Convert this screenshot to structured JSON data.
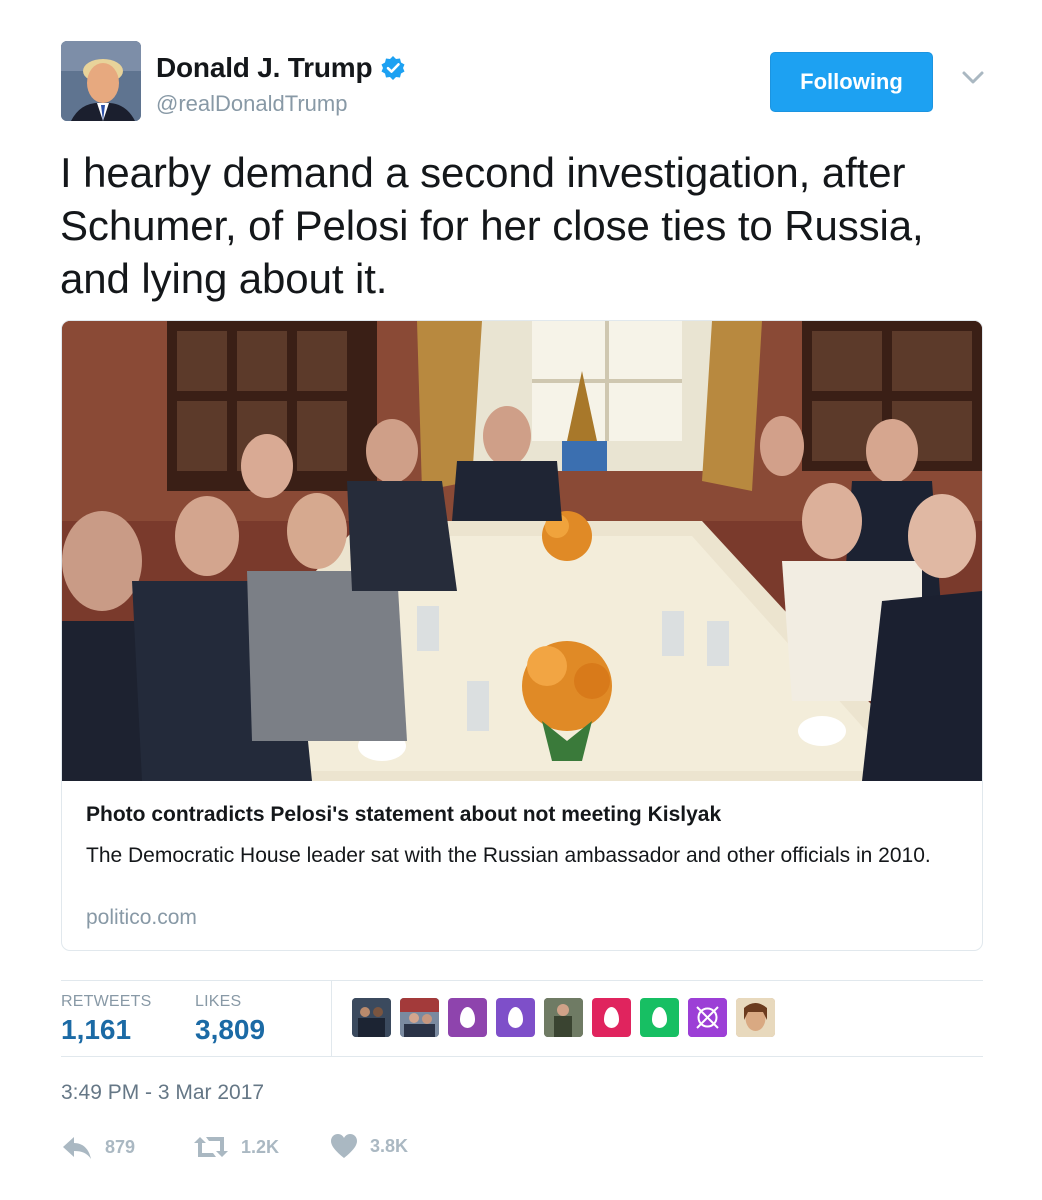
{
  "header": {
    "display_name": "Donald J. Trump",
    "handle": "@realDonaldTrump",
    "follow_label": "Following"
  },
  "tweet": {
    "text": "I hearby demand a second investigation, after Schumer, of Pelosi for her close ties to Russia, and lying about it."
  },
  "card": {
    "title": "Photo contradicts Pelosi's statement about not meeting Kislyak",
    "description": "The Democratic House leader sat with the Russian ambassador and other officials in 2010.",
    "domain": "politico.com"
  },
  "stats": {
    "retweets_label": "RETWEETS",
    "retweets_value": "1,161",
    "likes_label": "LIKES",
    "likes_value": "3,809",
    "likers": [
      {
        "kind": "photo",
        "color": "#3b4a5e"
      },
      {
        "kind": "photo",
        "color": "#5a6c84"
      },
      {
        "kind": "egg",
        "color": "#8e44ad"
      },
      {
        "kind": "egg",
        "color": "#7e4fc9"
      },
      {
        "kind": "photo",
        "color": "#4d5a4a"
      },
      {
        "kind": "egg",
        "color": "#e0245e"
      },
      {
        "kind": "egg",
        "color": "#17bf63"
      },
      {
        "kind": "icon",
        "color": "#9c3fd6"
      },
      {
        "kind": "photo",
        "color": "#c9a57a"
      }
    ]
  },
  "timestamp": "3:49 PM - 3 Mar 2017",
  "actions": {
    "reply_count": "879",
    "retweet_count": "1.2K",
    "like_count": "3.8K"
  },
  "colors": {
    "accent": "#1da1f2",
    "stat_value": "#1b6aa5",
    "muted": "#8899a6",
    "action_icon": "#aab8c2"
  }
}
